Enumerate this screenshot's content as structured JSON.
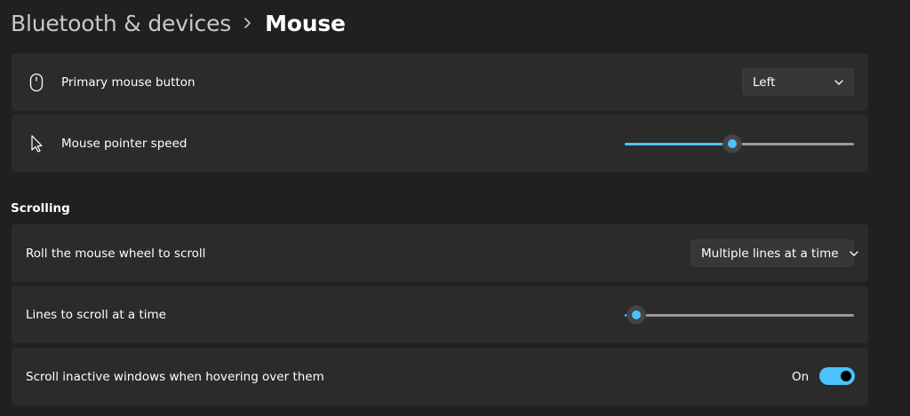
{
  "breadcrumb": {
    "parent": "Bluetooth & devices",
    "separator_icon": "chevron-right-icon",
    "current": "Mouse"
  },
  "primary_button": {
    "icon": "mouse-icon",
    "label": "Primary mouse button",
    "value": "Left",
    "dropdown_icon": "chevron-down-icon"
  },
  "pointer_speed": {
    "icon": "pointer-arrow-icon",
    "label": "Mouse pointer speed",
    "value_fraction": 0.47
  },
  "scrolling": {
    "heading": "Scrolling",
    "roll_wheel": {
      "label": "Roll the mouse wheel to scroll",
      "value": "Multiple lines at a time",
      "dropdown_icon": "chevron-down-icon"
    },
    "lines_to_scroll": {
      "label": "Lines to scroll at a time",
      "value_fraction": 0.05
    },
    "inactive_windows": {
      "label": "Scroll inactive windows when hovering over them",
      "state_text": "On",
      "enabled": true
    }
  },
  "colors": {
    "background": "#202020",
    "card": "#2b2b2b",
    "accent": "#4cc2ff"
  }
}
